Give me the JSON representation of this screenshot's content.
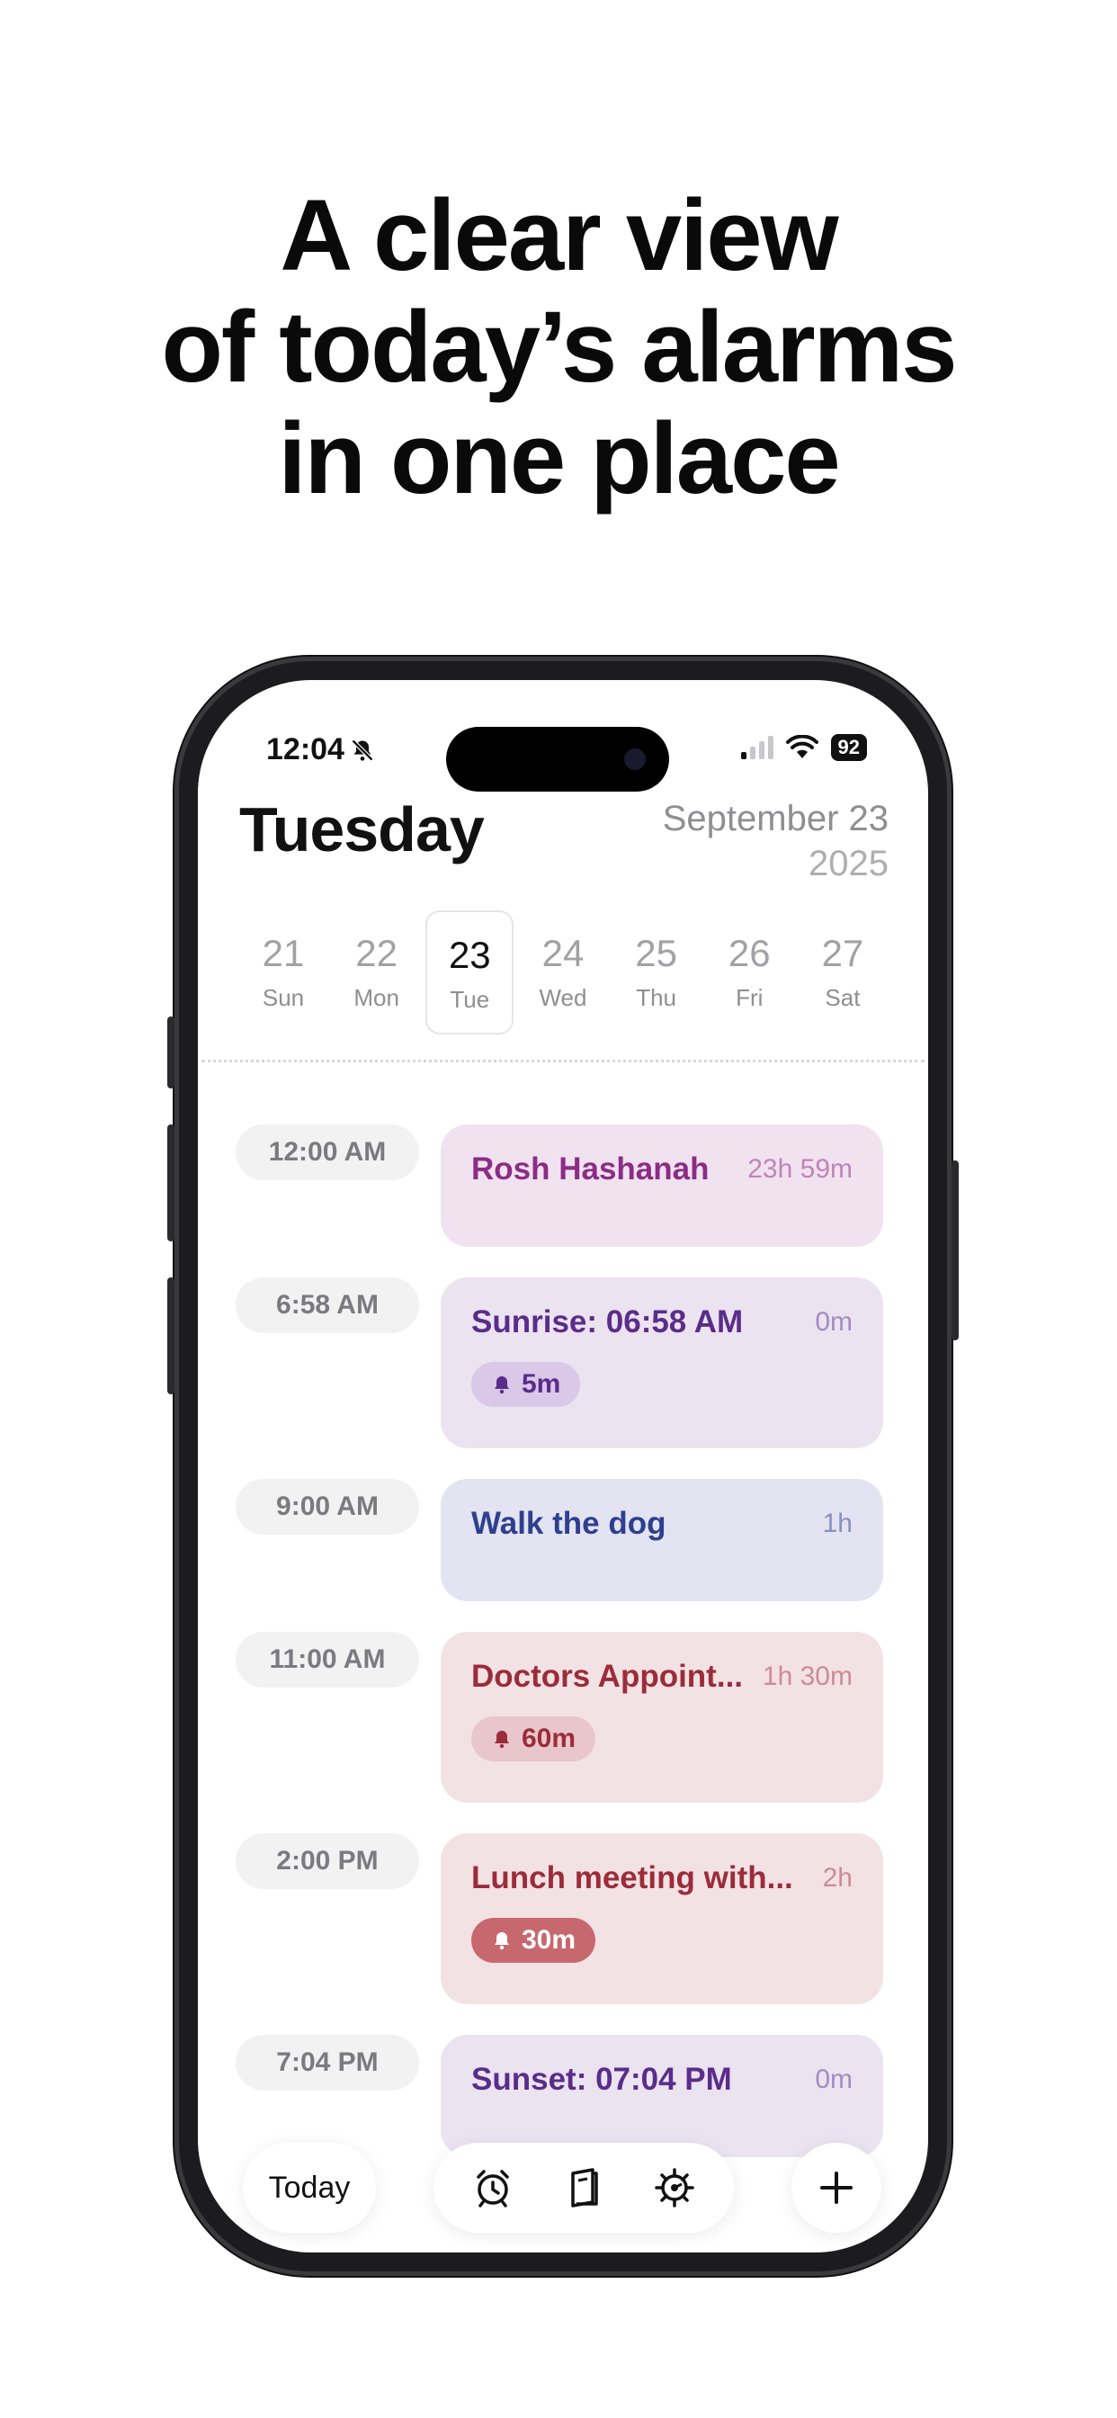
{
  "headline": [
    "A clear view",
    "of today’s alarms",
    "in one place"
  ],
  "status": {
    "time": "12:04",
    "battery": "92",
    "silent_icon": "bell-slash-icon"
  },
  "header": {
    "day": "Tuesday",
    "month_day": "September 23",
    "year": "2025"
  },
  "week": [
    {
      "num": "21",
      "label": "Sun"
    },
    {
      "num": "22",
      "label": "Mon"
    },
    {
      "num": "23",
      "label": "Tue",
      "selected": true
    },
    {
      "num": "24",
      "label": "Wed"
    },
    {
      "num": "25",
      "label": "Thu"
    },
    {
      "num": "26",
      "label": "Fri"
    },
    {
      "num": "27",
      "label": "Sat"
    }
  ],
  "events": [
    {
      "time": "12:00 AM",
      "title": "Rosh Hashanah",
      "duration": "23h 59m"
    },
    {
      "time": "6:58 AM",
      "title": "Sunrise: 06:58 AM",
      "duration": "0m",
      "alert": "5m"
    },
    {
      "time": "9:00 AM",
      "title": "Walk the dog",
      "duration": "1h"
    },
    {
      "time": "11:00 AM",
      "title": "Doctors Appoint...",
      "duration": "1h 30m",
      "alert": "60m"
    },
    {
      "time": "2:00 PM",
      "title": "Lunch meeting with...",
      "duration": "2h",
      "alert": "30m"
    },
    {
      "time": "7:04 PM",
      "title": "Sunset: 07:04 PM",
      "duration": "0m"
    }
  ],
  "toolbar": {
    "today_label": "Today",
    "icons": [
      "alarm-clock-icon",
      "journal-icon",
      "gear-icon",
      "plus-icon"
    ]
  },
  "colors": {
    "rosh": "#8b2d86",
    "sun": "#5a2d8a",
    "dog": "#2e3f8f",
    "doctor": "#9c2c3a"
  }
}
